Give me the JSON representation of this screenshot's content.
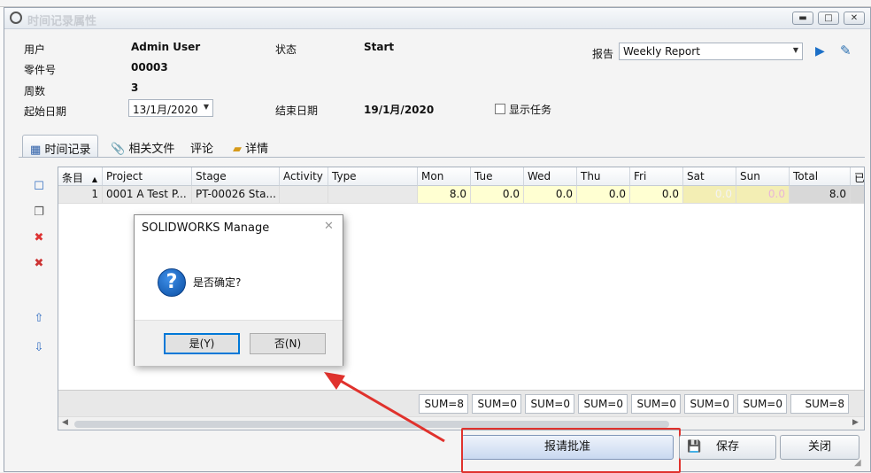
{
  "window": {
    "title": "时间记录属性"
  },
  "fields": {
    "user_label": "用户",
    "user_value": "Admin User",
    "part_label": "零件号",
    "part_value": "00003",
    "week_label": "周数",
    "week_value": "3",
    "start_label": "起始日期",
    "start_value": "13/1月/2020",
    "status_label": "状态",
    "status_value": "Start",
    "end_label": "结束日期",
    "end_value": "19/1月/2020",
    "show_tasks_label": "显示任务",
    "report_label": "报告",
    "report_value": "Weekly Report"
  },
  "tabs": [
    "时间记录",
    "相关文件",
    "评论",
    "详情"
  ],
  "grid": {
    "headers": [
      "条目",
      "Project",
      "Stage",
      "Activity",
      "Type",
      "Mon",
      "Tue",
      "Wed",
      "Thu",
      "Fri",
      "Sat",
      "Sun",
      "Total",
      "已"
    ],
    "sort_indicator": "▲",
    "row": [
      "1",
      "0001 A Test P...",
      "PT-00026 Sta...",
      "",
      "",
      "8.0",
      "0.0",
      "0.0",
      "0.0",
      "0.0",
      "0.0",
      "0.0",
      "8.0"
    ],
    "sums": [
      "SUM=8",
      "SUM=0",
      "SUM=0",
      "SUM=0",
      "SUM=0",
      "SUM=0",
      "SUM=0",
      "SUM=8"
    ]
  },
  "buttons": {
    "approve": "报请批准",
    "save": "保存",
    "close": "关闭"
  },
  "dialog": {
    "title": "SOLIDWORKS Manage",
    "message": "是否确定?",
    "yes": "是(Y)",
    "no": "否(N)",
    "icon_glyph": "?"
  },
  "colors": {
    "highlight_cell": "#ffffd2",
    "weekend_cell": "#f3eeb4",
    "annotation_red": "#e0322d",
    "total_cell": "#d8d8d8"
  }
}
